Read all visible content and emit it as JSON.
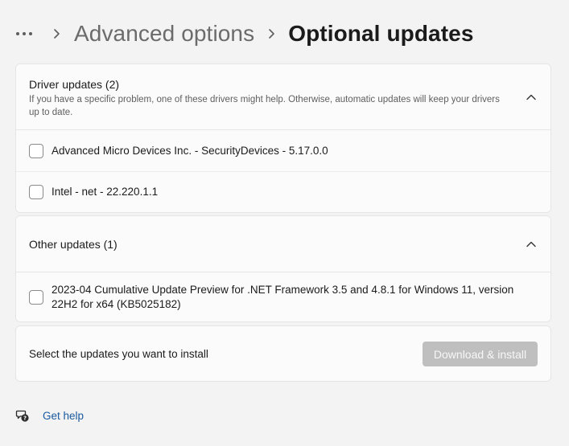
{
  "breadcrumb": {
    "more_icon": "ellipsis-icon",
    "parent": "Advanced options",
    "current": "Optional updates"
  },
  "driver_updates": {
    "title": "Driver updates (2)",
    "description": "If you have a specific problem, one of these drivers might help. Otherwise, automatic updates will keep your drivers up to date.",
    "expanded": true,
    "items": [
      {
        "label": "Advanced Micro Devices Inc. - SecurityDevices - 5.17.0.0",
        "checked": false
      },
      {
        "label": "Intel - net - 22.220.1.1",
        "checked": false
      }
    ]
  },
  "other_updates": {
    "title": "Other updates (1)",
    "expanded": true,
    "items": [
      {
        "label": "2023-04 Cumulative Update Preview for .NET Framework 3.5 and 4.8.1 for Windows 11, version 22H2 for x64 (KB5025182)",
        "checked": false
      }
    ]
  },
  "install": {
    "prompt": "Select the updates you want to install",
    "button_label": "Download & install",
    "button_enabled": false
  },
  "help": {
    "icon": "help-chat-icon",
    "label": "Get help"
  },
  "colors": {
    "background": "#f3f3f3",
    "card": "#fbfbfb",
    "disabled_button": "#bfbfbf",
    "link": "#1a5aa0"
  }
}
